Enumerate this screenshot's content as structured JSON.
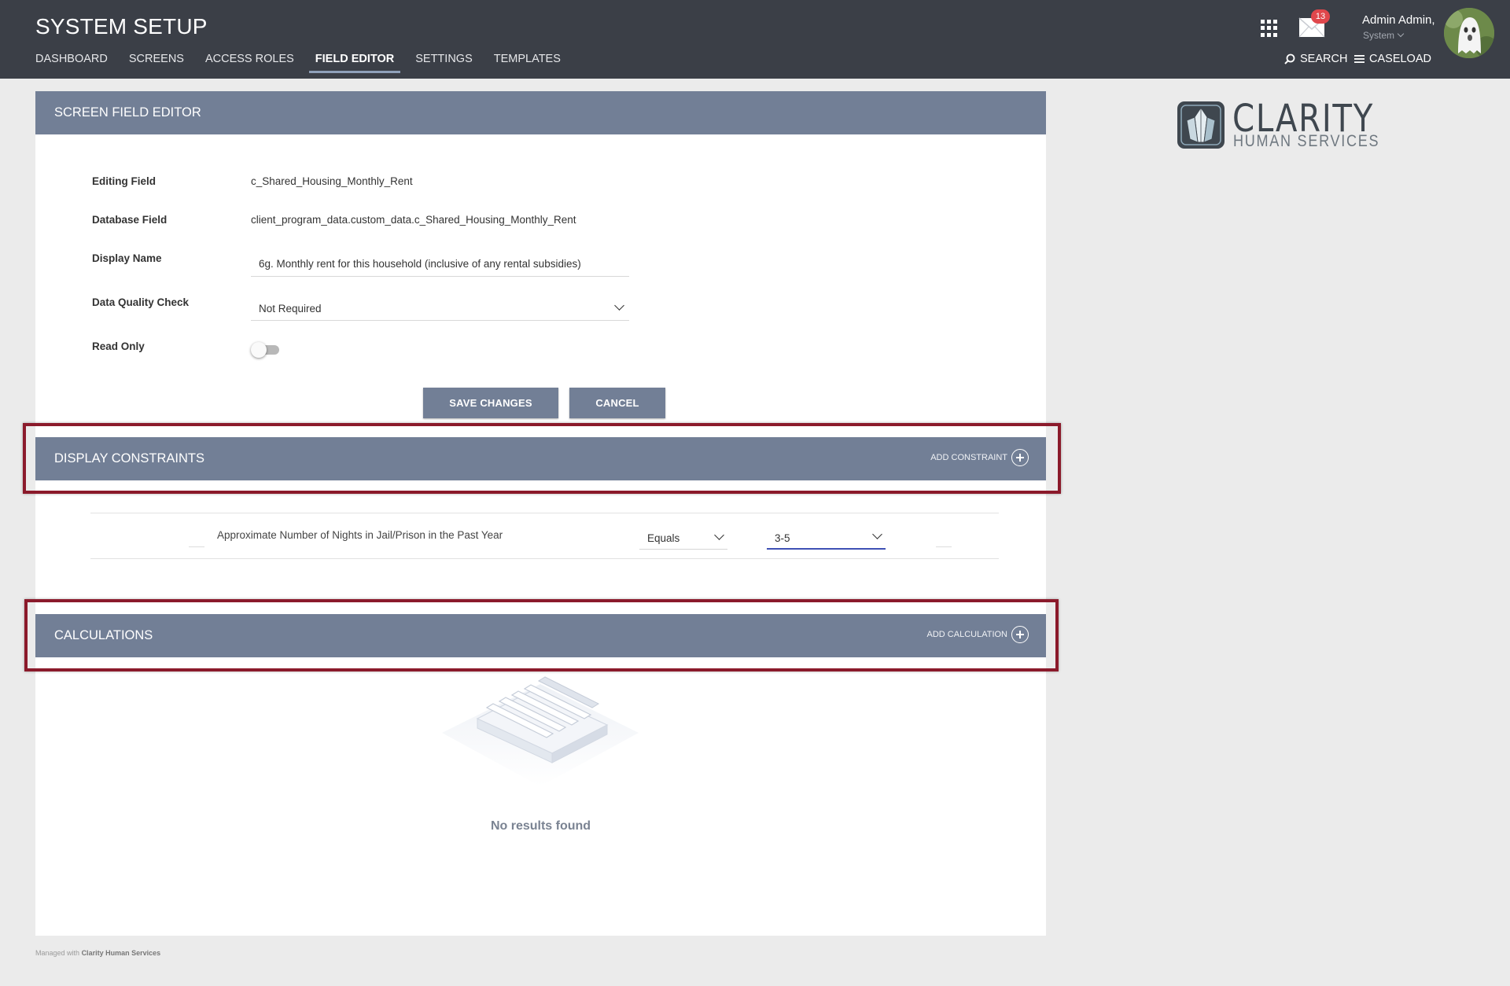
{
  "app": {
    "title": "SYSTEM SETUP"
  },
  "nav": {
    "items": [
      {
        "label": "DASHBOARD"
      },
      {
        "label": "SCREENS"
      },
      {
        "label": "ACCESS ROLES"
      },
      {
        "label": "FIELD EDITOR",
        "active": true
      },
      {
        "label": "SETTINGS"
      },
      {
        "label": "TEMPLATES"
      }
    ]
  },
  "header_right": {
    "mail_badge": "13",
    "user_name": "Admin Admin,",
    "user_role": "System",
    "search_label": "SEARCH",
    "caseload_label": "CASELOAD"
  },
  "logo": {
    "word": "CLARITY",
    "sub": "HUMAN SERVICES"
  },
  "editor": {
    "title": "SCREEN FIELD EDITOR",
    "editing_field_label": "Editing Field",
    "editing_field_value": "c_Shared_Housing_Monthly_Rent",
    "database_field_label": "Database Field",
    "database_field_value": "client_program_data.custom_data.c_Shared_Housing_Monthly_Rent",
    "display_name_label": "Display Name",
    "display_name_value": "6g. Monthly rent for this household (inclusive of any rental subsidies)",
    "dq_check_label": "Data Quality Check",
    "dq_check_value": "Not Required",
    "read_only_label": "Read Only",
    "read_only_on": false,
    "save_label": "SAVE CHANGES",
    "cancel_label": "CANCEL"
  },
  "constraints": {
    "title": "DISPLAY CONSTRAINTS",
    "add_label": "ADD CONSTRAINT",
    "rows": [
      {
        "field": "Approximate Number of Nights in Jail/Prison in the Past Year",
        "operator": "Equals",
        "value": "3-5"
      }
    ]
  },
  "calculations": {
    "title": "CALCULATIONS",
    "add_label": "ADD CALCULATION",
    "empty_text": "No results found"
  },
  "footer": {
    "prefix": "Managed with",
    "brand": "Clarity Human Services"
  },
  "colors": {
    "topbar": "#3b3f47",
    "section_header": "#727f96",
    "highlight": "#8b1a2b",
    "badge": "#e0474c",
    "focus_underline": "#3f51b5"
  }
}
